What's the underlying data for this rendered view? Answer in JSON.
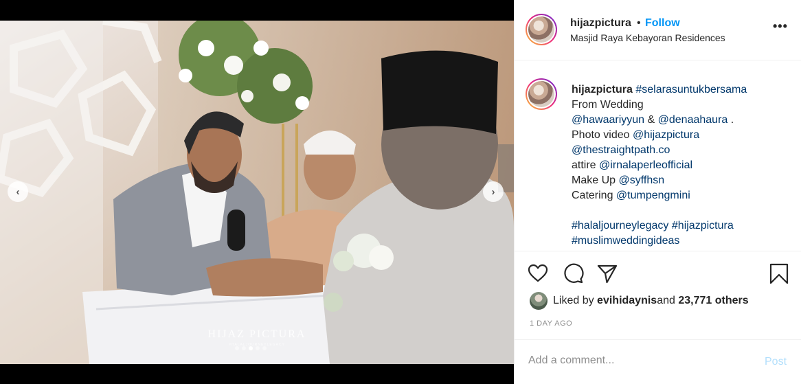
{
  "media": {
    "watermark": "HIJAZ PICTURA",
    "watermark_sub": "#HALALJOURNEYLEGACY",
    "prev_icon": "chevron-left-icon",
    "next_icon": "chevron-right-icon",
    "dots_count": 5,
    "active_dot": 3
  },
  "header": {
    "username": "hijazpictura",
    "separator": "•",
    "follow_label": "Follow",
    "location": "Masjid Raya Kebayoran Residences",
    "more_icon": "more-horizontal-icon"
  },
  "caption": {
    "username": "hijazpictura",
    "hashtag1": "#selarasuntukbersama",
    "from_wedding": "From Wedding",
    "mention1": "@hawaariyyun",
    "amp": " & ",
    "mention2": "@denaahaura",
    "dot": " .",
    "photo_video_label": "Photo video ",
    "mention3": "@hijazpictura",
    "mention4": "@thestraightpath.co",
    "attire_label": "attire ",
    "mention5": "@irnalaperleofficial",
    "makeup_label": "Make Up ",
    "mention6": "@syffhsn",
    "catering_label": "Catering ",
    "mention7": "@tumpengmini",
    "hashtag2": "#halaljourneylegacy",
    "space": " ",
    "hashtag3": "#hijazpictura",
    "hashtag4": "#muslimweddingideas"
  },
  "actions": {
    "like_icon": "heart-icon",
    "comment_icon": "comment-icon",
    "share_icon": "share-icon",
    "save_icon": "bookmark-icon"
  },
  "likes": {
    "prefix": "Liked by ",
    "user": "evihidaynis",
    "and": " and ",
    "others": "23,771 others"
  },
  "timestamp": "1 DAY AGO",
  "comment": {
    "placeholder": "Add a comment...",
    "post_label": "Post"
  },
  "colors": {
    "link": "#00376b",
    "follow": "#0095f6",
    "post_disabled": "#b2dffc",
    "muted": "#8e8e8e"
  }
}
